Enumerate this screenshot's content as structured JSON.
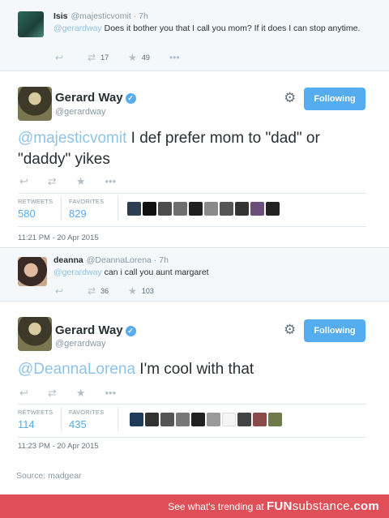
{
  "reply1": {
    "name": "Isis",
    "handle_time": "@majesticvomit · 7h",
    "mention": "@gerardway",
    "text": " Does it bother you that I call you mom? If it does I can stop anytime.",
    "retweets": "17",
    "favorites": "49"
  },
  "tweet1": {
    "name": "Gerard Way",
    "handle": "@gerardway",
    "follow_label": "Following",
    "mention": "@majesticvomit",
    "text": " I def prefer mom to \"dad\" or \"daddy\" yikes",
    "retweets_label": "RETWEETS",
    "retweets": "580",
    "favorites_label": "FAVORITES",
    "favorites": "829",
    "timestamp": "11:21 PM - 20 Apr 2015"
  },
  "reply2": {
    "name": "deanna",
    "handle_time": "@DeannaLorena · 7h",
    "mention": "@gerardway",
    "text": " can i call you aunt margaret",
    "retweets": "36",
    "favorites": "103"
  },
  "tweet2": {
    "name": "Gerard Way",
    "handle": "@gerardway",
    "follow_label": "Following",
    "mention": "@DeannaLorena",
    "text": " I'm cool with that",
    "retweets_label": "RETWEETS",
    "retweets": "114",
    "favorites_label": "FAVORITES",
    "favorites": "435",
    "timestamp": "11:23 PM - 20 Apr 2015"
  },
  "source": "Source: madgear",
  "banner": {
    "text": "See what's trending at ",
    "brand_bold": "FUN",
    "brand_light": "substance",
    "brand_suffix": ".com"
  },
  "icons": {
    "reply": "reply-icon",
    "retweet": "retweet-icon",
    "favorite": "star-icon",
    "more": "more-icon",
    "settings": "gear-icon",
    "verified": "verified-icon"
  },
  "colors": {
    "accent": "#55acee",
    "mention": "#8ec3ea",
    "banner": "#e04f57",
    "reply_bg": "#f5f8fa"
  }
}
